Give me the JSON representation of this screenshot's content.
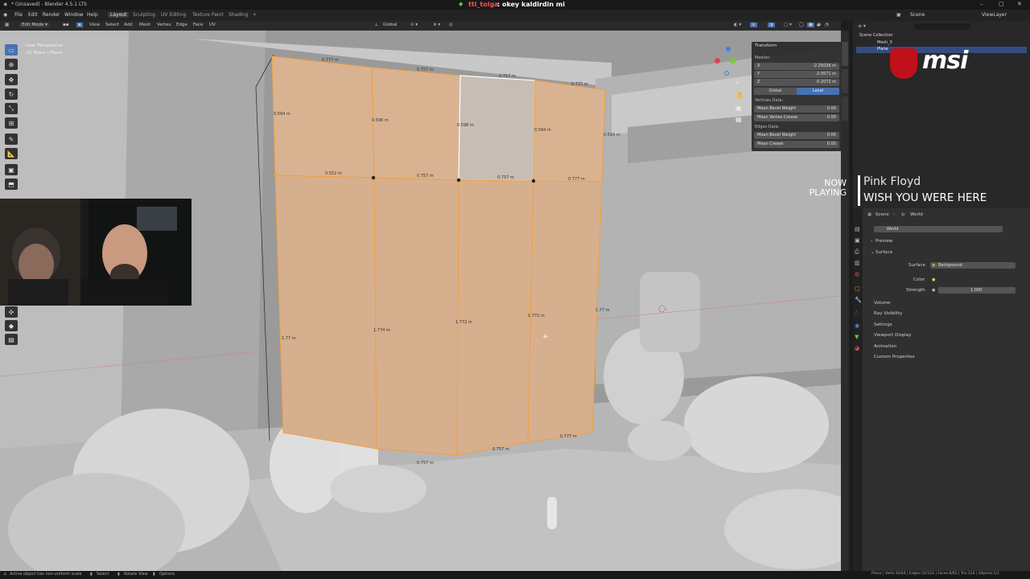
{
  "window": {
    "title": "* (Unsaved) - Blender 4.5.1 LTS"
  },
  "chat": {
    "user": "ttl_tolga",
    "message": "okey kaldirdin mi"
  },
  "menu": {
    "items": [
      "File",
      "Edit",
      "Render",
      "Window",
      "Help"
    ]
  },
  "workspaces": {
    "items": [
      "Layout",
      "Sculpting",
      "UV Editing",
      "Texture Paint",
      "Shading"
    ],
    "add": "+"
  },
  "toolheader": {
    "mode": "Edit Mode",
    "items": [
      "View",
      "Select",
      "Add",
      "Mesh",
      "Vertex",
      "Edge",
      "Face",
      "UV"
    ],
    "orientation": "Global",
    "options": "Options"
  },
  "viewport": {
    "perspective": "User Perspective",
    "object": "(0) Plane | Plane"
  },
  "npanel": {
    "title": "Transform",
    "median_label": "Median:",
    "x": {
      "label": "X",
      "value": "-2.25028 m"
    },
    "y": {
      "label": "Y",
      "value": "-2.0571 m"
    },
    "z": {
      "label": "Z",
      "value": "0.2072 m"
    },
    "global": "Global",
    "local": "Local",
    "vertices_data": "Vertices Data:",
    "mean_bevel_weight": {
      "label": "Mean Bevel Weight",
      "value": "0.00"
    },
    "mean_vertex_crease": {
      "label": "Mean Vertex Crease",
      "value": "0.00"
    },
    "edges_data": "Edges Data:",
    "edge_bevel_weight": {
      "label": "Mean Bevel Weight",
      "value": "0.00"
    },
    "mean_crease": {
      "label": "Mean Crease",
      "value": "0.00"
    }
  },
  "dimensions": {
    "top_row": [
      "0.777 m",
      "0.757 m",
      "0.757 m",
      "0.777 m"
    ],
    "mid_row": [
      "0.552 m",
      "0.757 m",
      "0.757 m",
      "0.777 m"
    ],
    "left": [
      "0.594 m",
      "0.596 m",
      "0.598 m",
      "0.594 m",
      "0.594 m"
    ],
    "heights": [
      "1.77 m",
      "1.774 m",
      "1.772 m",
      "1.772 m",
      "1.77 m"
    ],
    "bottom": [
      "0.757 m",
      "0.757 m",
      "0.777 m"
    ]
  },
  "outliner": {
    "collection": "Scene Collection",
    "items": [
      "Mesh_0",
      "Plane"
    ],
    "scene": "Scene",
    "view_layer": "ViewLayer"
  },
  "overlay": {
    "brand": "msi",
    "now_playing": "NOW PLAYING",
    "artist": "Pink Floyd",
    "song": "WISH YOU WERE HERE"
  },
  "properties": {
    "breadcrumb_scene": "Scene",
    "breadcrumb_world": "World",
    "world_name": "World",
    "sections": [
      "Preview",
      "Surface"
    ],
    "surface_label": "Surface",
    "surface_value": "Background",
    "color_label": "Color",
    "strength_label": "Strength",
    "strength_value": "1.000",
    "collapsed": [
      "Volume",
      "Ray Visibility",
      "Settings",
      "Viewport Display",
      "Animation",
      "Custom Properties"
    ]
  },
  "statusbar": {
    "warning": "Active object has non-uniform scale",
    "select": "Select",
    "rotate": "Rotate View",
    "options": "Options",
    "stats": "Plane | Verts:32/64 | Edges:52/124 | Faces:6/62 | Tris:124 | Objects:1/2"
  },
  "colors": {
    "accent": "#4772b3",
    "selected_face": "#d8b08c",
    "edge_orange": "#f0a040",
    "chat_user": "#ff5050"
  }
}
